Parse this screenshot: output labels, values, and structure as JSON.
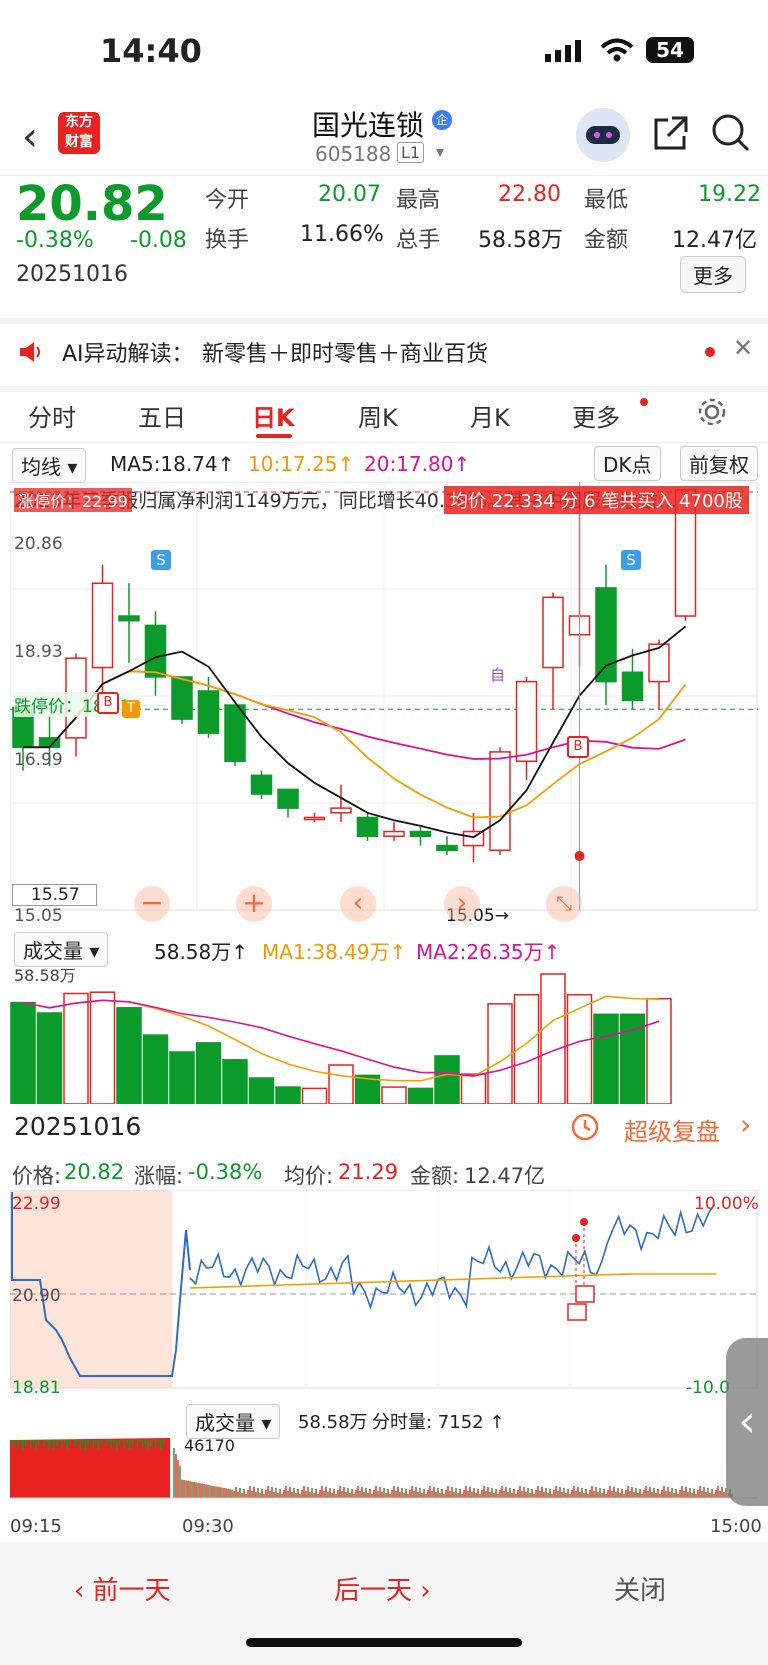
{
  "status": {
    "time": "14:40",
    "battery": "54"
  },
  "header": {
    "title": "国光连锁",
    "code": "605188",
    "level_badge": "L1",
    "badge_letter": "企"
  },
  "quote": {
    "price": "20.82",
    "change_pct": "-0.38%",
    "change": "-0.08",
    "date": "20251016",
    "stats": [
      {
        "label": "今开",
        "value": "20.07"
      },
      {
        "label": "最高",
        "value": "22.80"
      },
      {
        "label": "最低",
        "value": "19.22"
      },
      {
        "label": "换手",
        "value": "11.66%"
      },
      {
        "label": "总手",
        "value": "58.58万"
      },
      {
        "label": "金额",
        "value": "12.47亿"
      }
    ],
    "more_label": "更多"
  },
  "ai_banner": {
    "prefix": "AI异动解读：",
    "text": "新零售＋即时零售＋商业百货"
  },
  "tabs": [
    "分时",
    "五日",
    "日K",
    "周K",
    "月K",
    "更多"
  ],
  "active_tab": 2,
  "ma_bar": {
    "selector": "均线",
    "ma5": "MA5:18.74↑",
    "ma10": "10:17.25↑",
    "ma20": "20:17.80↑",
    "dk": "DK点",
    "adjust": "前复权"
  },
  "kline": {
    "news": "2025年三季报归属净利润1149万元，同比增长40.36%。其中中国服务收益…",
    "limit_up_label": "涨停价：22.99",
    "limit_down_label": "跌停价：18.31",
    "avg_label": "均价 22.334 分 6 笔共买入 4700股",
    "y_labels": [
      "20.86",
      "18.93",
      "16.99",
      "15.05"
    ],
    "crosshair_price": "15.57",
    "low_marker": "15.05→",
    "self_marker": "自",
    "signals": {
      "s": "S",
      "b": "B",
      "t": "T"
    }
  },
  "chart_data": {
    "type": "candlestick",
    "ylim": [
      15.05,
      22.99
    ],
    "candles": [
      {
        "o": 18.35,
        "c": 17.5,
        "h": 18.5,
        "l": 17.0
      },
      {
        "o": 17.7,
        "c": 17.5,
        "h": 18.2,
        "l": 17.1
      },
      {
        "o": 17.7,
        "c": 19.4,
        "h": 19.5,
        "l": 17.3
      },
      {
        "o": 19.2,
        "c": 21.0,
        "h": 21.4,
        "l": 18.5
      },
      {
        "o": 20.3,
        "c": 20.2,
        "h": 21.0,
        "l": 19.3
      },
      {
        "o": 20.1,
        "c": 19.0,
        "h": 20.4,
        "l": 18.6
      },
      {
        "o": 19.0,
        "c": 18.1,
        "h": 19.0,
        "l": 18.0
      },
      {
        "o": 18.7,
        "c": 17.8,
        "h": 19.0,
        "l": 17.7
      },
      {
        "o": 18.4,
        "c": 17.2,
        "h": 18.4,
        "l": 17.1
      },
      {
        "o": 16.9,
        "c": 16.5,
        "h": 17.0,
        "l": 16.4
      },
      {
        "o": 16.6,
        "c": 16.2,
        "h": 16.6,
        "l": 16.0
      },
      {
        "o": 16.0,
        "c": 16.0,
        "h": 16.1,
        "l": 15.9
      },
      {
        "o": 16.1,
        "c": 16.2,
        "h": 16.7,
        "l": 15.9
      },
      {
        "o": 16.0,
        "c": 15.6,
        "h": 16.1,
        "l": 15.5
      },
      {
        "o": 15.6,
        "c": 15.7,
        "h": 15.9,
        "l": 15.5
      },
      {
        "o": 15.7,
        "c": 15.6,
        "h": 15.8,
        "l": 15.4
      },
      {
        "o": 15.4,
        "c": 15.3,
        "h": 15.6,
        "l": 15.2
      },
      {
        "o": 15.4,
        "c": 15.7,
        "h": 16.1,
        "l": 15.05
      },
      {
        "o": 15.3,
        "c": 17.4,
        "h": 17.5,
        "l": 15.2
      },
      {
        "o": 17.2,
        "c": 18.9,
        "h": 19.0,
        "l": 16.8
      },
      {
        "o": 19.2,
        "c": 20.7,
        "h": 20.8,
        "l": 18.3
      },
      {
        "o": 19.9,
        "c": 20.3,
        "h": 22.8,
        "l": 19.22
      },
      {
        "o": 20.9,
        "c": 18.9,
        "h": 21.4,
        "l": 18.4
      },
      {
        "o": 19.1,
        "c": 18.5,
        "h": 19.6,
        "l": 18.3
      },
      {
        "o": 18.9,
        "c": 19.7,
        "h": 19.8,
        "l": 18.3
      },
      {
        "o": 20.3,
        "c": 22.99,
        "h": 22.99,
        "l": 20.2
      }
    ],
    "volume_max": "58.58万",
    "volumes": [
      0.78,
      0.7,
      0.85,
      0.86,
      0.74,
      0.53,
      0.4,
      0.47,
      0.34,
      0.2,
      0.13,
      0.12,
      0.3,
      0.22,
      0.13,
      0.12,
      0.37,
      0.23,
      0.77,
      0.84,
      1.0,
      0.84,
      0.69,
      0.69,
      0.81
    ]
  },
  "volume": {
    "label": "成交量",
    "value": "58.58万↑",
    "ma1": "MA1:38.49万↑",
    "ma2": "MA2:26.35万↑"
  },
  "bottom": {
    "date": "20251016",
    "review": "超级复盘"
  },
  "intraday": {
    "price": "价格:",
    "price_v": "20.82",
    "chg": "涨幅:",
    "chg_v": "-0.38%",
    "avg": "均价:",
    "avg_v": "21.29",
    "amt": "金额:",
    "amt_v": "12.47亿",
    "high": "22.99",
    "mid": "20.90",
    "low": "18.81",
    "pct_high": "10.00%",
    "pct_low": "-10.0"
  },
  "intraday_vol": {
    "label": "成交量",
    "value": "58.58万",
    "minute": "分时量: 7152 ↑",
    "peak": "46170"
  },
  "times": {
    "start": "09:15",
    "open": "09:30",
    "end": "15:00"
  },
  "footer": {
    "prev": "前一天",
    "next": "后一天",
    "close": "关闭"
  }
}
